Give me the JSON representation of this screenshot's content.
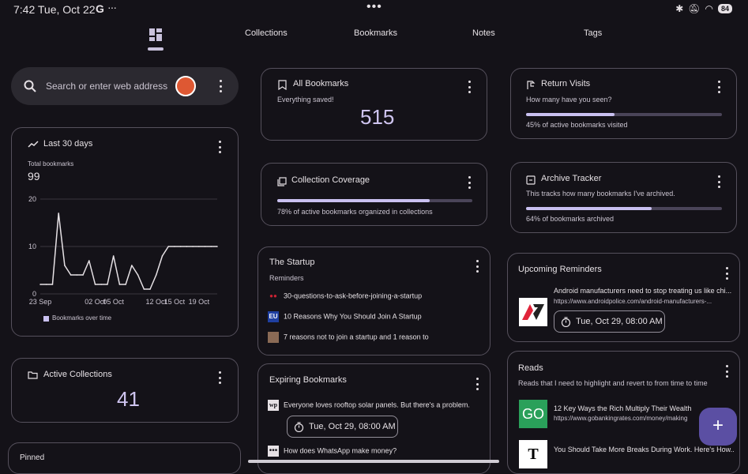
{
  "status": {
    "time": "7:42",
    "date": "Tue, Oct 22",
    "g": "G",
    "overflow": "···",
    "center_dots": "•••",
    "battery": "84"
  },
  "tabs": [
    {
      "label": "Collections"
    },
    {
      "label": "Bookmarks"
    },
    {
      "label": "Notes"
    },
    {
      "label": "Tags"
    }
  ],
  "search": {
    "placeholder": "Search or enter web address"
  },
  "last30": {
    "title": "Last 30 days",
    "sub": "Total bookmarks",
    "total": "99",
    "legend": "Bookmarks over time"
  },
  "chart_data": {
    "type": "line",
    "title": "Last 30 days",
    "xlabel": "",
    "ylabel": "",
    "x": [
      "23 Sep",
      "24 Sep",
      "25 Sep",
      "26 Sep",
      "27 Sep",
      "28 Sep",
      "29 Sep",
      "30 Sep",
      "01 Oct",
      "02 Oct",
      "03 Oct",
      "04 Oct",
      "05 Oct",
      "06 Oct",
      "07 Oct",
      "08 Oct",
      "09 Oct",
      "10 Oct",
      "11 Oct",
      "12 Oct",
      "13 Oct",
      "14 Oct",
      "15 Oct",
      "16 Oct",
      "17 Oct",
      "18 Oct",
      "19 Oct",
      "20 Oct",
      "21 Oct",
      "22 Oct"
    ],
    "x_ticks": [
      "23 Sep",
      "02 Oct",
      "05 Oct",
      "12 Oct",
      "15 Oct",
      "19 Oct"
    ],
    "series": [
      {
        "name": "Bookmarks over time",
        "values": [
          2,
          2,
          2,
          17,
          6,
          4,
          4,
          4,
          7,
          2,
          2,
          2,
          8,
          2,
          2,
          6,
          4,
          1,
          1,
          4,
          8,
          10,
          10,
          10,
          10,
          10,
          10,
          10,
          10,
          10
        ]
      }
    ],
    "y_ticks": [
      "0",
      "10",
      "20"
    ],
    "ylim": [
      0,
      20
    ],
    "grid": true,
    "legend": "bottom-left",
    "color": "#e6e1e5"
  },
  "active_collections": {
    "title": "Active Collections",
    "value": "41"
  },
  "all_bookmarks": {
    "title": "All Bookmarks",
    "sub": "Everything saved!",
    "value": "515"
  },
  "coverage": {
    "title": "Collection Coverage",
    "caption": "78% of active bookmarks organized in collections",
    "progress": 0.78
  },
  "startup": {
    "title": "The Startup",
    "sub": "Reminders",
    "items": [
      {
        "icon": "medium",
        "text": "30-questions-to-ask-before-joining-a-startup"
      },
      {
        "icon": "EU",
        "text": "10 Reasons Why You Should Join A Startup"
      },
      {
        "icon": "photo",
        "text": "7 reasons not to join a startup and 1 reason to"
      }
    ]
  },
  "expiring": {
    "title": "Expiring Bookmarks",
    "items": [
      {
        "icon": "wp",
        "text": "Everyone loves rooftop solar panels. But there's a problem.",
        "chip": "Tue, Oct 29, 08:00 AM"
      },
      {
        "icon": "dots",
        "text": "How does WhatsApp make money?"
      }
    ]
  },
  "return_visits": {
    "title": "Return Visits",
    "sub": "How many have you seen?",
    "caption": "45% of active bookmarks visited",
    "progress": 0.45
  },
  "archive": {
    "title": "Archive Tracker",
    "sub": "This tracks how many bookmarks I've archived.",
    "caption": "64% of bookmarks archived",
    "progress": 0.64
  },
  "reminders": {
    "title": "Upcoming Reminders",
    "item": {
      "title": "Android manufacturers need to stop treating us like chi...",
      "url": "https://www.androidpolice.com/android-manufacturers-...",
      "chip": "Tue, Oct 29, 08:00 AM"
    }
  },
  "reads": {
    "title": "Reads",
    "sub": "Reads that I need to highlight and revert to from time to time",
    "items": [
      {
        "logo": "GO",
        "title": "12 Key Ways the Rich Multiply Their Wealth",
        "url": "https://www.gobankingrates.com/money/making"
      },
      {
        "logo": "NYT",
        "title": "You Should Take More Breaks During Work. Here's How..."
      }
    ]
  },
  "pinned": {
    "title": "Pinned"
  },
  "colors": {
    "accent": "#c9c0f0",
    "fab": "#5b4fa3",
    "background": "#141218"
  }
}
